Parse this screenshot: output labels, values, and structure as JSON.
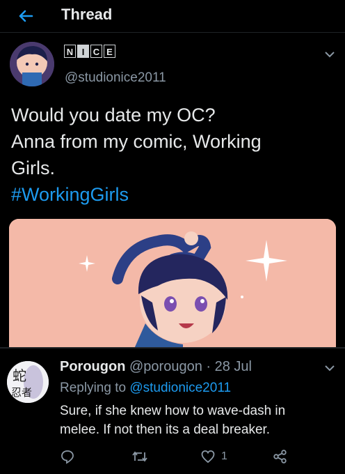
{
  "header": {
    "title": "Thread"
  },
  "tweet": {
    "name_letters": [
      "N",
      "I",
      "C",
      "E"
    ],
    "name_filled": [
      false,
      true,
      false,
      false
    ],
    "handle": "@studionice2011",
    "lines": [
      "Would you date my OC?",
      "Anna from my comic, Working",
      "Girls."
    ],
    "hashtag": "#WorkingGirls"
  },
  "reply": {
    "display_name": "Porougon",
    "meta": " @porougon · 28 Jul",
    "replying_prefix": "Replying to ",
    "replying_handle": "@studionice2011",
    "text_lines": [
      "Sure, if she knew how to wave-dash in",
      "melee. If not then its a deal breaker."
    ],
    "like_count": "1",
    "avatar_glyphs": [
      "蛇",
      "忍者"
    ]
  },
  "colors": {
    "accent": "#1d9bf0",
    "muted": "#8b98a5",
    "text": "#e7e9ea"
  }
}
